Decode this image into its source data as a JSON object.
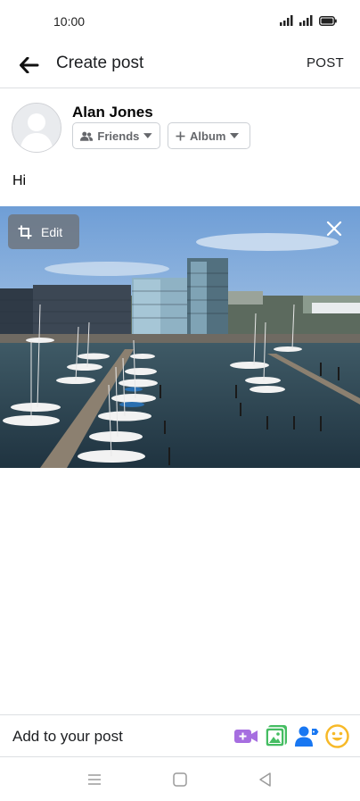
{
  "status_bar": {
    "time": "10:00"
  },
  "app_bar": {
    "title": "Create post",
    "post_label": "POST"
  },
  "author": {
    "name": "Alan Jones",
    "audience_label": "Friends",
    "album_label": "Album"
  },
  "post": {
    "text": "Hi"
  },
  "photo": {
    "edit_label": "Edit"
  },
  "add_to_post": {
    "label": "Add to your post"
  },
  "colors": {
    "live_video": "#a66ee0",
    "photo": "#45bd62",
    "tag_people": "#1877f2",
    "feeling": "#f7b928"
  }
}
